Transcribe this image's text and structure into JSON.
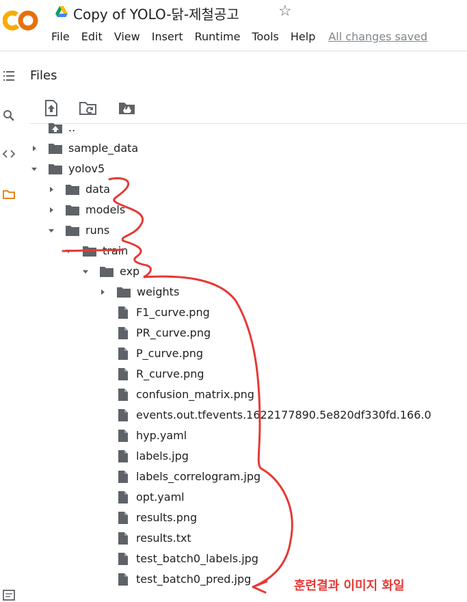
{
  "header": {
    "logo_text": "CO",
    "title": "Copy of YOLO-닭-제철공고",
    "star_icon": "star-outline-icon",
    "menu": [
      "File",
      "Edit",
      "View",
      "Insert",
      "Runtime",
      "Tools",
      "Help"
    ],
    "save_status": "All changes saved"
  },
  "leftrail": {
    "icons": [
      "table-of-contents-icon",
      "search-icon",
      "code-icon",
      "folder-icon",
      "terminal-icon"
    ]
  },
  "files_panel": {
    "title": "Files",
    "toolbar": [
      "upload-icon",
      "refresh-folder-icon",
      "mount-drive-icon"
    ]
  },
  "tree": {
    "parent": "..",
    "items": [
      {
        "label": "sample_data",
        "type": "folder",
        "expanded": false
      },
      {
        "label": "yolov5",
        "type": "folder",
        "expanded": true
      },
      {
        "label": "data",
        "type": "folder",
        "expanded": false
      },
      {
        "label": "models",
        "type": "folder",
        "expanded": false
      },
      {
        "label": "runs",
        "type": "folder",
        "expanded": true
      },
      {
        "label": "train",
        "type": "folder",
        "expanded": true
      },
      {
        "label": "exp",
        "type": "folder",
        "expanded": true
      },
      {
        "label": "weights",
        "type": "folder",
        "expanded": false
      },
      {
        "label": "F1_curve.png",
        "type": "file"
      },
      {
        "label": "PR_curve.png",
        "type": "file"
      },
      {
        "label": "P_curve.png",
        "type": "file"
      },
      {
        "label": "R_curve.png",
        "type": "file"
      },
      {
        "label": "confusion_matrix.png",
        "type": "file"
      },
      {
        "label": "events.out.tfevents.1622177890.5e820df330fd.166.0",
        "type": "file"
      },
      {
        "label": "hyp.yaml",
        "type": "file"
      },
      {
        "label": "labels.jpg",
        "type": "file"
      },
      {
        "label": "labels_correlogram.jpg",
        "type": "file"
      },
      {
        "label": "opt.yaml",
        "type": "file"
      },
      {
        "label": "results.png",
        "type": "file"
      },
      {
        "label": "results.txt",
        "type": "file"
      },
      {
        "label": "test_batch0_labels.jpg",
        "type": "file"
      },
      {
        "label": "test_batch0_pred.jpg",
        "type": "file"
      }
    ]
  },
  "annotation": {
    "text": "훈련결과 이미지 화일",
    "color": "#e53935"
  },
  "colors": {
    "logo_orange": "#F9AB00",
    "logo_dark_orange": "#E8710A",
    "icon_gray": "#5f6368",
    "active_folder": "#e37400"
  }
}
